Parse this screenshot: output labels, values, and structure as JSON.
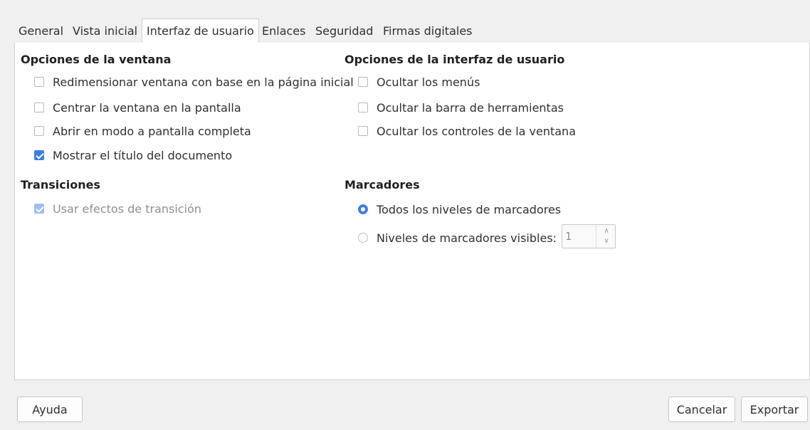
{
  "tabs": [
    {
      "label": "General"
    },
    {
      "label": "Vista inicial"
    },
    {
      "label": "Interfaz de usuario",
      "active": true
    },
    {
      "label": "Enlaces"
    },
    {
      "label": "Seguridad"
    },
    {
      "label": "Firmas digitales"
    }
  ],
  "window_options": {
    "title": "Opciones de la ventana",
    "items": [
      {
        "label": "Redimensionar ventana con base en la página inicial",
        "checked": false
      },
      {
        "label": "Centrar la ventana en la pantalla",
        "checked": false
      },
      {
        "label": "Abrir en modo a pantalla completa",
        "checked": false
      },
      {
        "label": "Mostrar el título del documento",
        "checked": true
      }
    ]
  },
  "ui_options": {
    "title": "Opciones de la interfaz de usuario",
    "items": [
      {
        "label": "Ocultar los menús",
        "checked": false
      },
      {
        "label": "Ocultar la barra de herramientas",
        "checked": false
      },
      {
        "label": "Ocultar los controles de la ventana",
        "checked": false
      }
    ]
  },
  "transitions": {
    "title": "Transiciones",
    "items": [
      {
        "label": "Usar efectos de transición",
        "checked": true,
        "disabled": true
      }
    ]
  },
  "bookmarks": {
    "title": "Marcadores",
    "options": [
      {
        "label": "Todos los niveles de marcadores",
        "selected": true
      },
      {
        "label": "Niveles de marcadores visibles:",
        "selected": false
      }
    ],
    "levels_value": "1"
  },
  "buttons": {
    "help": "Ayuda",
    "cancel": "Cancelar",
    "export": "Exportar"
  },
  "colors": {
    "accent": "#3d7ee6",
    "background": "#f0f0f0",
    "panel": "#ffffff"
  }
}
